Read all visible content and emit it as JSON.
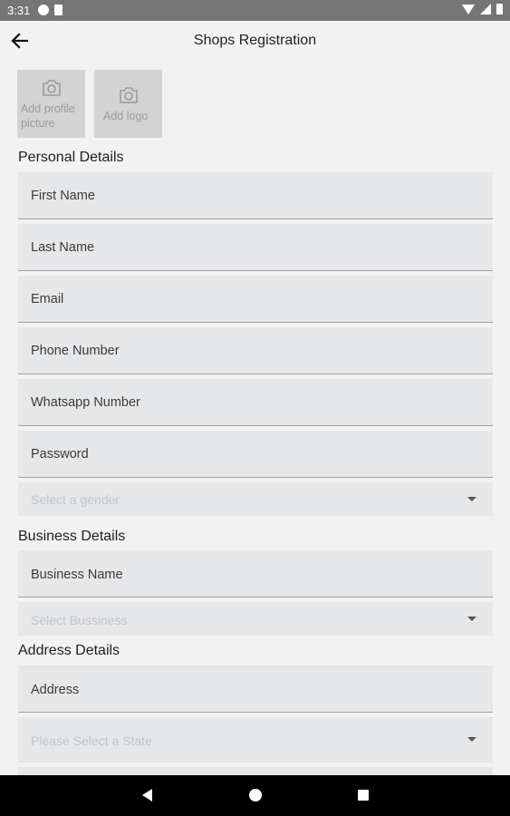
{
  "status_bar": {
    "time": "3:31"
  },
  "header": {
    "title": "Shops Registration"
  },
  "photo": {
    "profile_label_line1": "Add profile",
    "profile_label_line2": "picture",
    "logo_label": "Add logo"
  },
  "personal": {
    "title": "Personal Details",
    "first_name": "First Name",
    "last_name": "Last Name",
    "email": "Email",
    "phone": "Phone Number",
    "whatsapp": "Whatsapp Number",
    "password": "Password",
    "gender_placeholder": "Select a gender"
  },
  "business": {
    "title": "Business Details",
    "name": "Business Name",
    "type_placeholder": "Select Bussiness"
  },
  "address": {
    "title": "Address Details",
    "address": "Address",
    "state_placeholder": "Please Select a State"
  },
  "colors": {
    "field_bg": "#e6e7e9",
    "page_bg": "#f2f2f2",
    "status_bar": "#757575"
  }
}
